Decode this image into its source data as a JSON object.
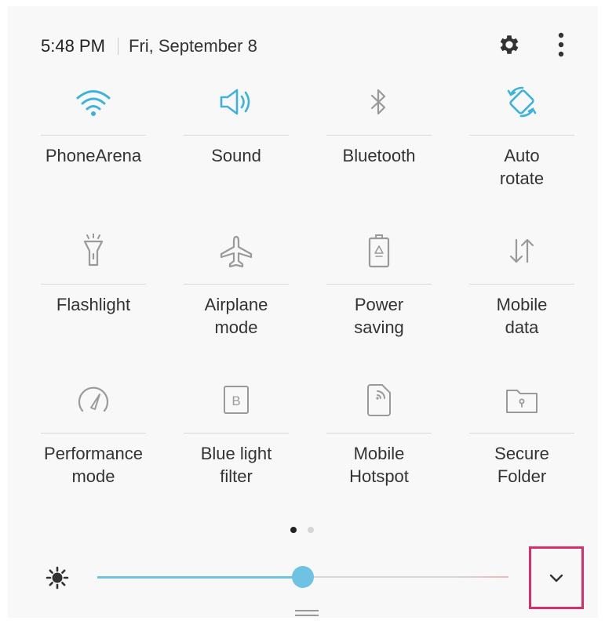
{
  "status_bar": {
    "time": "5:48 PM",
    "date": "Fri, September 8",
    "settings_icon": "gear-icon",
    "more_icon": "more-vertical-icon"
  },
  "tiles": [
    {
      "label": "PhoneArena",
      "icon": "wifi-icon",
      "active": true
    },
    {
      "label": "Sound",
      "icon": "speaker-icon",
      "active": true
    },
    {
      "label": "Bluetooth",
      "icon": "bluetooth-icon",
      "active": false
    },
    {
      "label": "Auto\nrotate",
      "icon": "auto-rotate-icon",
      "active": true
    },
    {
      "label": "Flashlight",
      "icon": "flashlight-icon",
      "active": false
    },
    {
      "label": "Airplane\nmode",
      "icon": "airplane-icon",
      "active": false
    },
    {
      "label": "Power\nsaving",
      "icon": "battery-saver-icon",
      "active": false
    },
    {
      "label": "Mobile\ndata",
      "icon": "mobile-data-icon",
      "active": false
    },
    {
      "label": "Performance\nmode",
      "icon": "gauge-icon",
      "active": false
    },
    {
      "label": "Blue light\nfilter",
      "icon": "blue-light-filter-icon",
      "active": false,
      "glyph": "B"
    },
    {
      "label": "Mobile\nHotspot",
      "icon": "hotspot-icon",
      "active": false
    },
    {
      "label": "Secure\nFolder",
      "icon": "secure-folder-icon",
      "active": false
    }
  ],
  "pagination": {
    "current_page": 1,
    "total_pages": 2
  },
  "brightness": {
    "icon": "brightness-icon",
    "level": 0.5
  },
  "expand_icon": "chevron-down-icon",
  "colors": {
    "active_icon": "#3db2de",
    "inactive_icon": "#9a9a9a",
    "slider_accent": "#6ec2e2",
    "highlight_border": "#d62f6c"
  }
}
